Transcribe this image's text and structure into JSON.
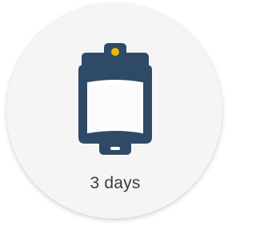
{
  "item": {
    "icon": "blood-bag-icon",
    "label": "3 days"
  },
  "colors": {
    "card_background": "#f5f5f5",
    "icon_navy": "#2f4a66",
    "icon_accent": "#f2b705",
    "icon_window": "#ffffff",
    "text": "#3b3b3b"
  }
}
